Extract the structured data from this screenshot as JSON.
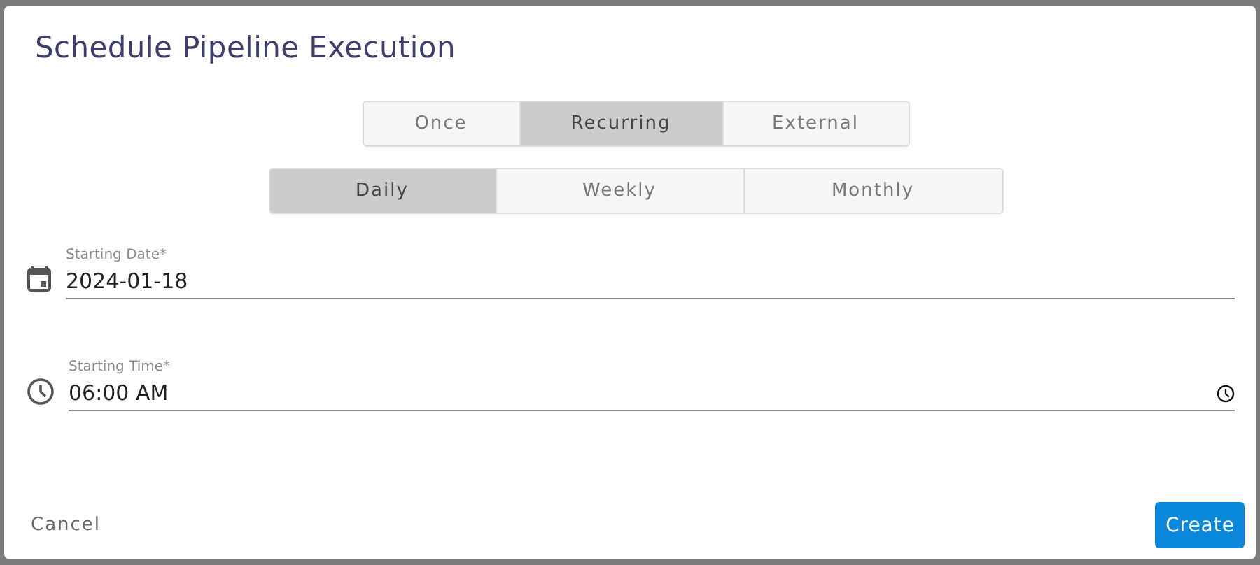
{
  "dialog": {
    "title": "Schedule Pipeline Execution"
  },
  "schedule_types": [
    {
      "label": "Once",
      "selected": false
    },
    {
      "label": "Recurring",
      "selected": true
    },
    {
      "label": "External",
      "selected": false
    }
  ],
  "frequencies": [
    {
      "label": "Daily",
      "selected": true
    },
    {
      "label": "Weekly",
      "selected": false
    },
    {
      "label": "Monthly",
      "selected": false
    }
  ],
  "fields": [
    {
      "kind": "date",
      "label": "Starting Date*",
      "value": "2024-01-18"
    },
    {
      "kind": "time",
      "label": "Starting Time*",
      "value": "06:00 AM"
    }
  ],
  "buttons": {
    "cancel": "Cancel",
    "create": "Create"
  }
}
